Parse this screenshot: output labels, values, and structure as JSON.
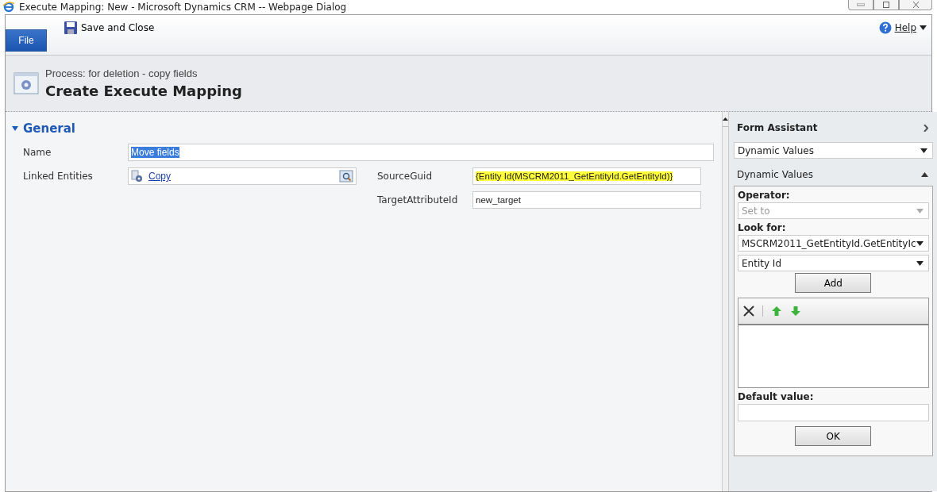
{
  "window": {
    "title": "Execute Mapping: New - Microsoft Dynamics CRM -- Webpage Dialog"
  },
  "ribbon": {
    "file_tab": "File",
    "save_button": "Save and Close",
    "help": "Help"
  },
  "header": {
    "breadcrumb": "Process: for deletion - copy fields",
    "title": "Create Execute Mapping"
  },
  "section": {
    "title": "General",
    "expanded": true
  },
  "name_field": {
    "label": "Name",
    "value": "Move fields",
    "selected": true
  },
  "left_fields": [
    {
      "kind": "lookup",
      "label": "Linked Entities",
      "value": "Copy"
    }
  ],
  "right_fields": [
    {
      "kind": "text",
      "label": "SourceGuid",
      "value": "{Entity Id(MSCRM2011_GetEntityId.GetEntityId)}",
      "highlighted": true
    },
    {
      "kind": "text",
      "label": "TargetAttributeId",
      "value": "new_target",
      "highlighted": false
    }
  ],
  "form_assistant": {
    "title": "Form Assistant",
    "mode": "Dynamic Values",
    "section": "Dynamic Values",
    "expanded": true,
    "operator_label": "Operator:",
    "operator": {
      "value": "Set to",
      "disabled": true
    },
    "look_for_label": "Look for:",
    "look_for": "MSCRM2011_GetEntityId.GetEntityIc",
    "attribute": "Entity Id",
    "add_button": "Add",
    "default_label": "Default value:",
    "ok_button": "OK"
  }
}
